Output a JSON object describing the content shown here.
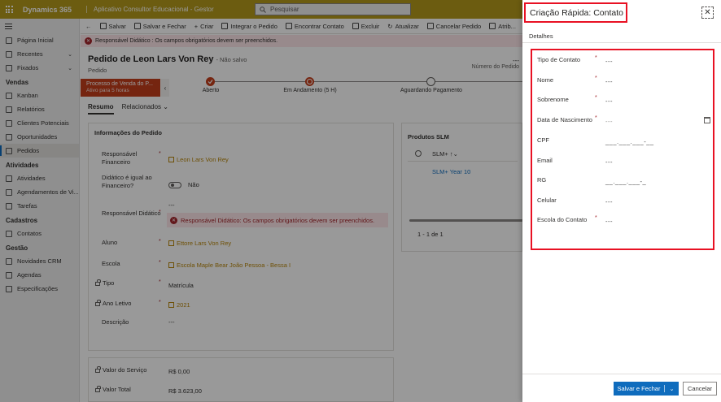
{
  "topbar": {
    "brand": "Dynamics 365",
    "app": "Aplicativo Consultor Educacional - Gestor",
    "search_placeholder": "Pesquisar"
  },
  "nav": {
    "home": "Página Inicial",
    "recent": "Recentes",
    "pinned": "Fixados",
    "groups": [
      "Vendas",
      "Atividades",
      "Cadastros",
      "Gestão"
    ],
    "vendas": [
      "Kanban",
      "Relatórios",
      "Clientes Potenciais",
      "Oportunidades",
      "Pedidos"
    ],
    "atividades": [
      "Atividades",
      "Agendamentos de Vi...",
      "Tarefas"
    ],
    "cadastros": [
      "Contatos"
    ],
    "gestao": [
      "Novidades CRM",
      "Agendas",
      "Especificações"
    ]
  },
  "commands": [
    "Salvar",
    "Salvar e Fechar",
    "Criar",
    "Integrar o Pedido",
    "Encontrar Contato",
    "Excluir",
    "Atualizar",
    "Cancelar Pedido",
    "Atrib..."
  ],
  "notification": "Responsável Didático : Os campos obrigatórios devem ser preenchidos.",
  "record": {
    "title": "Pedido de Leon Lars Von Rey",
    "unsaved": "- Não salvo",
    "entity": "Pedido",
    "header_value": "---",
    "header_label": "Número do Pedido"
  },
  "bpf": {
    "stage_name": "Processo de Venda do P...",
    "stage_time": "Ativo para 5 horas",
    "stages": [
      "Aberto",
      "Em Andamento  (5 H)",
      "Aguardando Pagamento"
    ]
  },
  "tabs": [
    "Resumo",
    "Relacionados"
  ],
  "form": {
    "section_title": "Informações do Pedido",
    "resp_fin_label": "Responsável Financeiro",
    "resp_fin_value": "Leon Lars Von Rey",
    "didatico_igual_label": "Didático é igual ao Financeiro?",
    "didatico_igual_value": "Não",
    "resp_did_label": "Responsável Didático",
    "resp_did_value": "---",
    "resp_did_error": "Responsável Didático: Os campos obrigatórios devem ser preenchidos.",
    "aluno_label": "Aluno",
    "aluno_value": "Ettore Lars Von Rey",
    "escola_label": "Escola",
    "escola_value": "Escola Maple Bear João Pessoa - Bessa I",
    "tipo_label": "Tipo",
    "tipo_value": "Matrícula",
    "ano_label": "Ano Letivo",
    "ano_value": "2021",
    "descricao_label": "Descrição",
    "descricao_value": "---",
    "valor_servico_label": "Valor do Serviço",
    "valor_servico_value": "R$ 0,00",
    "valor_total_label": "Valor Total",
    "valor_total_value": "R$ 3.623,00"
  },
  "slm": {
    "title": "Produtos SLM",
    "col_header": "SLM+",
    "row_value": "SLM+ Year 10",
    "pager": "1 - 1 de 1"
  },
  "quick_create": {
    "title": "Criação Rápida: Contato",
    "section": "Detalhes",
    "fields": [
      {
        "label": "Tipo de Contato",
        "required": true,
        "value": "---"
      },
      {
        "label": "Nome",
        "required": true,
        "value": "---"
      },
      {
        "label": "Sobrenome",
        "required": true,
        "value": "---"
      },
      {
        "label": "Data de Nascimento",
        "required": true,
        "value": "---"
      },
      {
        "label": "CPF",
        "required": false,
        "value": "___.___.___-__"
      },
      {
        "label": "Email",
        "required": false,
        "value": "---"
      },
      {
        "label": "RG",
        "required": false,
        "value": "__.___.___-_"
      },
      {
        "label": "Celular",
        "required": false,
        "value": "---"
      },
      {
        "label": "Escola do Contato",
        "required": true,
        "value": "---"
      }
    ],
    "required_mark": "*",
    "save_close": "Salvar e Fechar",
    "cancel": "Cancelar"
  },
  "colors": {
    "topbar": "#b59a1c",
    "accent": "#c43e1c",
    "primary": "#0f6cbd",
    "highlight": "#e81123",
    "error": "#a4262c"
  }
}
